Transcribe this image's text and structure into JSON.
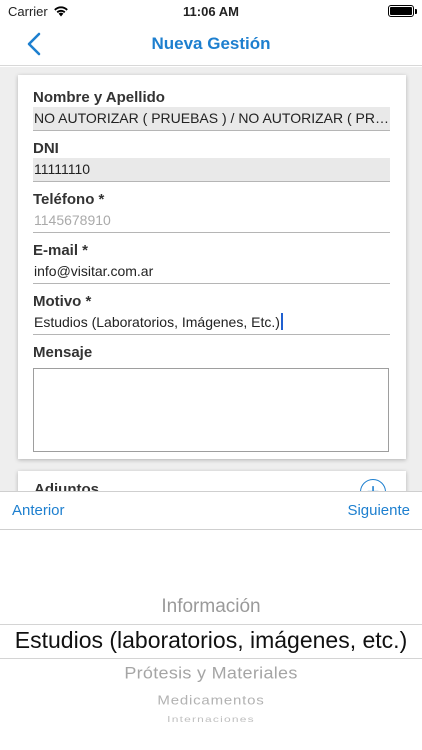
{
  "status_bar": {
    "carrier": "Carrier",
    "time": "11:06 AM"
  },
  "nav": {
    "title": "Nueva Gestión"
  },
  "form": {
    "nombre": {
      "label": "Nombre y Apellido",
      "value": "NO AUTORIZAR ( PRUEBAS ) / NO AUTORIZAR ( PRUEBAS )"
    },
    "dni": {
      "label": "DNI",
      "value": "11111110"
    },
    "telefono": {
      "label": "Teléfono *",
      "placeholder": "1145678910"
    },
    "email": {
      "label": "E-mail *",
      "value": "info@visitar.com.ar"
    },
    "motivo": {
      "label": "Motivo *",
      "value": "Estudios (Laboratorios, Imágenes, Etc.)"
    },
    "mensaje": {
      "label": "Mensaje",
      "value": ""
    }
  },
  "adjuntos": {
    "label": "Adjuntos"
  },
  "toolbar": {
    "previous_label": "Anterior",
    "next_label": "Siguiente"
  },
  "picker": {
    "options": [
      "Información",
      "Estudios (laboratorios, imágenes, etc.)",
      "Prótesis y Materiales",
      "Medicamentos",
      "Internaciones"
    ],
    "selected": "Estudios (laboratorios, imágenes, etc.)"
  },
  "colors": {
    "accent": "#1d7fcf",
    "background": "#eeeeee",
    "disabled_field": "#e9e9e9"
  }
}
